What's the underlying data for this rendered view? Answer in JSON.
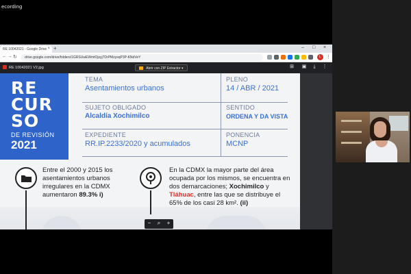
{
  "recording_label": "ecording",
  "browser": {
    "tab_title": "RE 10042021 - Google Drive",
    "new_tab": "+",
    "url": "drive.google.com/drive/folders/1GRSUwEWmtOjsyj7DrPMzysqP3P-KNdVeY",
    "avatar_letter": "L"
  },
  "viewer": {
    "file_name": "RE 10042021 V2.jpg",
    "open_with": "Abrir con ZIP Extractor",
    "zoom_minus": "−",
    "zoom_plus": "+"
  },
  "slide": {
    "recurso_line1": "RE",
    "recurso_line2": "CUR",
    "recurso_line3": "SO",
    "de_revision": "DE REVISIÓN",
    "year": "2021",
    "tema_label": "TEMA",
    "tema_value": "Asentamientos urbanos",
    "pleno_label": "PLENO",
    "pleno_value": "14 / ABR / 2021",
    "sujeto_label": "SUJETO OBLIGADO",
    "sujeto_value": "Alcaldía Xochimilco",
    "sentido_label": "SENTIDO",
    "sentido_value": "ORDENA Y DA VISTA",
    "expediente_label": "EXPEDIENTE",
    "expediente_value": "RR.IP.2233/2020 y acumulados",
    "ponencia_label": "PONENCIA",
    "ponencia_value": "MCNP",
    "fact1_text": "Entre el 2000 y 2015 los asentamientos urbanos irregulares en la CDMX aumentaron",
    "fact1_bold": "89.3% i)",
    "fact2_a": "En la CDMX la mayor parte del área ocupada por los mismos, se encuentra en dos demarcaciones;",
    "fact2_xoch": "Xochimilco",
    "fact2_y": "y",
    "fact2_tlah": "Tláhuac",
    "fact2_b": ", entre las que se distribuye el 65% de los casi 28 km².",
    "fact2_ii": "(ii)"
  },
  "colors": {
    "accent_blue": "#2e63c9",
    "value_blue": "#3a6fd8",
    "highlight_red": "#e0342c"
  }
}
